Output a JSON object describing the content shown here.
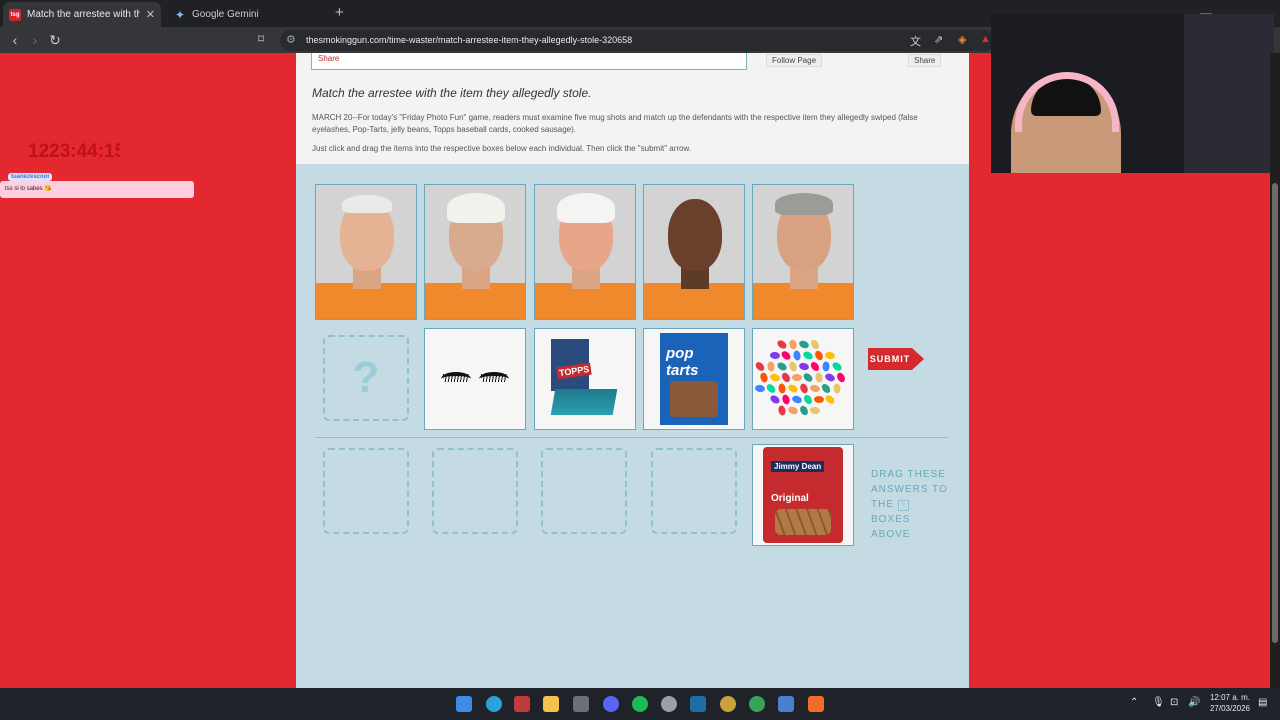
{
  "browser": {
    "tabs": [
      {
        "title": "Match the arrestee with the item",
        "favicon": "tsg-logo-icon",
        "active": true
      },
      {
        "title": "Google Gemini",
        "favicon": "gemini-icon",
        "active": false
      }
    ],
    "url": "thesmokinggun.com/time-waster/match-arrestee-item-they-allegedly-stole-320658"
  },
  "page": {
    "share_link": "Share",
    "follow_page": "Follow Page",
    "share_button": "Share",
    "heading": "Match the arrestee with the item they allegedly stole.",
    "description": "MARCH 20--For today's \"Friday Photo Fun\" game, readers must examine five mug shots and match up the defendants with the respective item they allegedly swiped (false eyelashes, Pop-Tarts, jelly beans, Topps baseball cards, cooked sausage).",
    "instructions": "Just click and drag the items into the respective boxes below each individual. Then click the \"submit\" arrow.",
    "placeholder_mark": "?",
    "submit_label": "SUBMIT",
    "drag_hint": {
      "line1": "DRAG THESE",
      "line2": "ANSWERS TO",
      "line3_a": "THE",
      "badge": "?",
      "line3_b": "BOXES",
      "line4": "ABOVE"
    },
    "items": {
      "topps": "TOPPS",
      "poptarts": "pop tarts",
      "sausage_brand": "Jimmy Dean",
      "sausage_name": "Original"
    }
  },
  "overlay": {
    "timer": "1223:44:15",
    "chat_user": "tuanezescool",
    "chat_message": "tss si lo sabes 😘"
  },
  "taskbar": {
    "time": "12:07 a. m.",
    "date": "27/03/2026"
  },
  "colors": {
    "background_red": "#e3282f",
    "game_blue": "#c5dbe4",
    "submit_red": "#d42a2e"
  }
}
